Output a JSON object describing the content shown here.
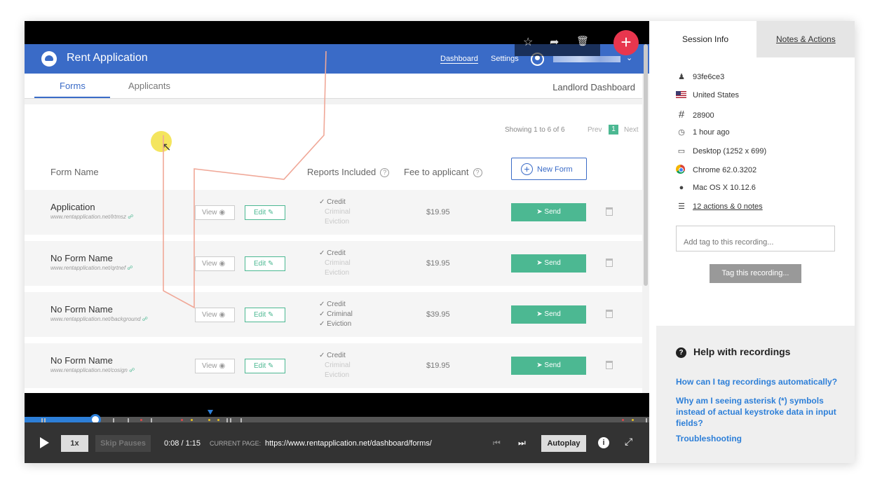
{
  "app": {
    "title": "Rent Application",
    "nav_dashboard": "Dashboard",
    "nav_settings": "Settings",
    "tab_forms": "Forms",
    "tab_applicants": "Applicants",
    "landlord": "Landlord Dashboard",
    "showing": "Showing 1 to 6 of 6",
    "prev": "Prev",
    "page": "1",
    "next": "Next",
    "columns": {
      "name": "Form Name",
      "reports": "Reports Included",
      "fee": "Fee to applicant",
      "new_form": "New Form"
    },
    "view_label": "View",
    "edit_label": "Edit",
    "send_label": "Send",
    "rows": [
      {
        "name": "Application",
        "url": "www.rentapplication.net/lrtmsz",
        "credit": "✓ Credit",
        "criminal": "Criminal",
        "eviction": "Eviction",
        "criminal_on": false,
        "eviction_on": false,
        "fee": "$19.95"
      },
      {
        "name": "No Form Name",
        "url": "www.rentapplication.net/qrtnef",
        "credit": "✓ Credit",
        "criminal": "Criminal",
        "eviction": "Eviction",
        "criminal_on": false,
        "eviction_on": false,
        "fee": "$19.95"
      },
      {
        "name": "No Form Name",
        "url": "www.rentapplication.net/background",
        "credit": "✓ Credit",
        "criminal": "✓ Criminal",
        "eviction": "✓ Eviction",
        "criminal_on": true,
        "eviction_on": true,
        "fee": "$39.95"
      },
      {
        "name": "No Form Name",
        "url": "www.rentapplication.net/cosign",
        "credit": "✓ Credit",
        "criminal": "Criminal",
        "eviction": "Eviction",
        "criminal_on": false,
        "eviction_on": false,
        "fee": "$19.95"
      }
    ]
  },
  "player": {
    "speed": "1x",
    "skip_pauses": "Skip Pauses",
    "time": "0:08 / 1:15",
    "current_page_label": "CURRENT PAGE:",
    "current_page": "https://www.rentapplication.net/dashboard/forms/",
    "autoplay": "Autoplay",
    "progress": 0.11
  },
  "session": {
    "tab_info": "Session Info",
    "tab_notes": "Notes & Actions",
    "user_id": "93fe6ce3",
    "country": "United States",
    "number": "28900",
    "time_ago": "1 hour ago",
    "device": "Desktop (1252 x 699)",
    "browser": "Chrome 62.0.3202",
    "os": "Mac OS X 10.12.6",
    "actions": "12 actions & 0 notes",
    "tag_placeholder": "Add tag to this recording...",
    "tag_button": "Tag this recording...",
    "help_title": "Help with recordings",
    "help_links": [
      "How can I tag recordings automatically?",
      "Why am I seeing asterisk (*) symbols instead of actual keystroke data in input fields?",
      "Troubleshooting"
    ]
  },
  "colors": {
    "brand_blue": "#3a6bc7",
    "send_green": "#4cb892",
    "fab_red": "#e8364e",
    "link_blue": "#2d7fd8"
  },
  "icons": [
    "star-icon",
    "share-icon",
    "trash-icon",
    "plus-icon",
    "user-icon",
    "flag-icon",
    "hash-icon",
    "clock-icon",
    "desktop-icon",
    "chrome-icon",
    "apple-icon",
    "list-icon",
    "help-icon",
    "play-icon",
    "eye-icon",
    "pencil-icon",
    "send-icon"
  ]
}
